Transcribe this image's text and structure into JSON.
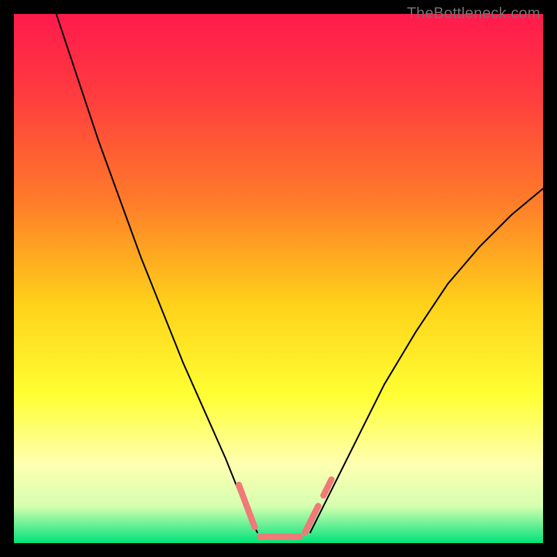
{
  "watermark": "TheBottleneck.com",
  "chart_data": {
    "type": "line",
    "title": "",
    "xlabel": "",
    "ylabel": "",
    "xlim": [
      0,
      100
    ],
    "ylim": [
      0,
      100
    ],
    "gradient_stops": [
      {
        "offset": 0.0,
        "color": "#ff1a4d"
      },
      {
        "offset": 0.15,
        "color": "#ff3b3f"
      },
      {
        "offset": 0.35,
        "color": "#ff7a2a"
      },
      {
        "offset": 0.55,
        "color": "#ffd21a"
      },
      {
        "offset": 0.72,
        "color": "#ffff33"
      },
      {
        "offset": 0.85,
        "color": "#ffffb0"
      },
      {
        "offset": 0.93,
        "color": "#d6ffb0"
      },
      {
        "offset": 1.0,
        "color": "#00e27a"
      }
    ],
    "series": [
      {
        "name": "left-curve",
        "x": [
          8,
          12,
          16,
          20,
          24,
          28,
          32,
          36,
          40,
          44,
          46
        ],
        "y": [
          100,
          88,
          76,
          65,
          54,
          44,
          34,
          25,
          16,
          6,
          2
        ]
      },
      {
        "name": "right-curve",
        "x": [
          56,
          58,
          62,
          66,
          70,
          76,
          82,
          88,
          94,
          100
        ],
        "y": [
          2,
          6,
          14,
          22,
          30,
          40,
          49,
          56,
          62,
          67
        ]
      }
    ],
    "markers": [
      {
        "name": "left-marker-1",
        "x1": 42.5,
        "y1": 11,
        "x2": 45.5,
        "y2": 3,
        "color": "#ef7a78",
        "width": 9
      },
      {
        "name": "bottom-marker",
        "x1": 46.5,
        "y1": 1.2,
        "x2": 54,
        "y2": 1.2,
        "color": "#ef7a78",
        "width": 9
      },
      {
        "name": "right-marker-1",
        "x1": 55,
        "y1": 2,
        "x2": 57.5,
        "y2": 7,
        "color": "#ef7a78",
        "width": 9
      },
      {
        "name": "right-marker-2",
        "x1": 58.5,
        "y1": 9,
        "x2": 60,
        "y2": 12,
        "color": "#ef7a78",
        "width": 9
      }
    ]
  }
}
